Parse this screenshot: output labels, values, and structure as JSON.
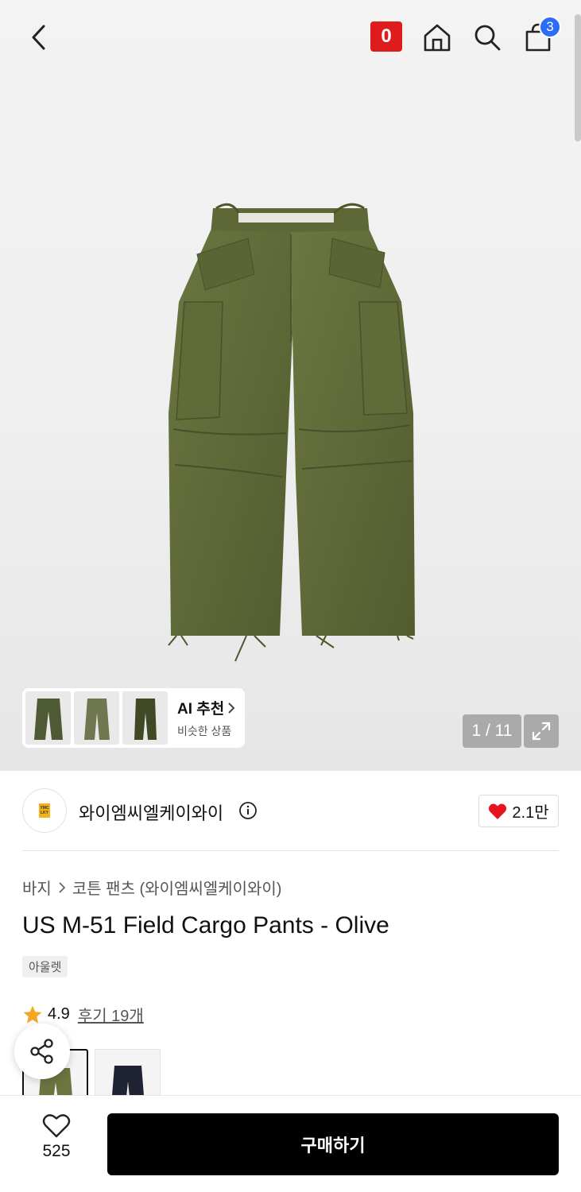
{
  "header": {
    "zero_badge": "0",
    "cart_count": "3",
    "icons": [
      "chevron-left-icon",
      "home-icon",
      "search-icon",
      "shopping-bag-icon"
    ]
  },
  "gallery": {
    "counter": "1 / 11",
    "ai_recommend": {
      "title": "AI 추천",
      "subtitle": "비슷한 상품"
    }
  },
  "brand": {
    "name": "와이엠씨엘케이와이",
    "logo_text": "YMC LKY",
    "likes": "2.1만"
  },
  "product": {
    "breadcrumb": [
      "바지",
      "코튼 팬츠 (와이엠씨엘케이와이)"
    ],
    "title": "US M-51 Field Cargo Pants - Olive",
    "tag": "아울렛",
    "rating": "4.9",
    "reviews": "후기 19개"
  },
  "bottom": {
    "wish_count": "525",
    "buy_label": "구매하기"
  },
  "colors": {
    "accent_red": "#e01b1b",
    "badge_blue": "#2b6ef5",
    "olive": "#5f6b3a",
    "star": "#f5a623",
    "heart": "#e5141d"
  }
}
